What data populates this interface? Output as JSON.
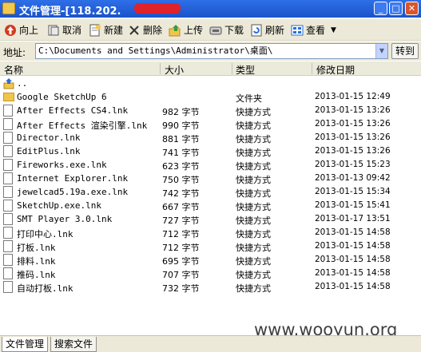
{
  "window": {
    "title": "文件管理-[118.202."
  },
  "toolbar": {
    "up": "向上",
    "cancel": "取消",
    "new": "新建",
    "delete": "删除",
    "upload": "上传",
    "download": "下载",
    "refresh": "刷新",
    "view": "查看"
  },
  "address": {
    "label": "地址:",
    "value": "C:\\Documents and Settings\\Administrator\\桌面\\",
    "go": "转到"
  },
  "columns": {
    "name": "名称",
    "size": "大小",
    "type": "类型",
    "modified": "修改日期"
  },
  "files": [
    {
      "name": "..",
      "size": "",
      "type": "",
      "date": "",
      "icon": "parent-folder-icon"
    },
    {
      "name": "Google SketchUp 6",
      "size": "",
      "type": "文件夹",
      "date": "2013-01-15 12:49",
      "icon": "folder-icon"
    },
    {
      "name": "After Effects CS4.lnk",
      "size": "982 字节",
      "type": "快捷方式",
      "date": "2013-01-15 13:26",
      "icon": "file-icon"
    },
    {
      "name": "After Effects 渲染引擎.lnk",
      "size": "990 字节",
      "type": "快捷方式",
      "date": "2013-01-15 13:26",
      "icon": "file-icon"
    },
    {
      "name": "Director.lnk",
      "size": "881 字节",
      "type": "快捷方式",
      "date": "2013-01-15 13:26",
      "icon": "file-icon"
    },
    {
      "name": "EditPlus.lnk",
      "size": "741 字节",
      "type": "快捷方式",
      "date": "2013-01-15 13:26",
      "icon": "file-icon"
    },
    {
      "name": "Fireworks.exe.lnk",
      "size": "623 字节",
      "type": "快捷方式",
      "date": "2013-01-15 15:23",
      "icon": "file-icon"
    },
    {
      "name": "Internet Explorer.lnk",
      "size": "750 字节",
      "type": "快捷方式",
      "date": "2013-01-13 09:42",
      "icon": "file-icon"
    },
    {
      "name": "jewelcad5.19a.exe.lnk",
      "size": "742 字节",
      "type": "快捷方式",
      "date": "2013-01-15 15:34",
      "icon": "file-icon"
    },
    {
      "name": "SketchUp.exe.lnk",
      "size": "667 字节",
      "type": "快捷方式",
      "date": "2013-01-15 15:41",
      "icon": "file-icon"
    },
    {
      "name": "SMT Player 3.0.lnk",
      "size": "727 字节",
      "type": "快捷方式",
      "date": "2013-01-17 13:51",
      "icon": "file-icon"
    },
    {
      "name": "打印中心.lnk",
      "size": "712 字节",
      "type": "快捷方式",
      "date": "2013-01-15 14:58",
      "icon": "file-icon"
    },
    {
      "name": "打板.lnk",
      "size": "712 字节",
      "type": "快捷方式",
      "date": "2013-01-15 14:58",
      "icon": "file-icon"
    },
    {
      "name": "排料.lnk",
      "size": "695 字节",
      "type": "快捷方式",
      "date": "2013-01-15 14:58",
      "icon": "file-icon"
    },
    {
      "name": "推码.lnk",
      "size": "707 字节",
      "type": "快捷方式",
      "date": "2013-01-15 14:58",
      "icon": "file-icon"
    },
    {
      "name": "自动打板.lnk",
      "size": "732 字节",
      "type": "快捷方式",
      "date": "2013-01-15 14:58",
      "icon": "file-icon"
    }
  ],
  "watermark": "www.wooyun.org",
  "tabs": {
    "file_manager": "文件管理",
    "search_files": "搜索文件"
  }
}
